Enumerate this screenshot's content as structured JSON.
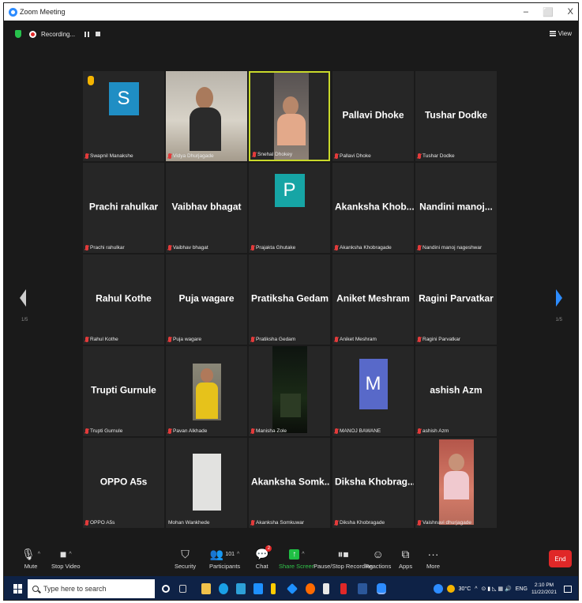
{
  "window": {
    "title": "Zoom Meeting",
    "controls": [
      "–",
      "⬜",
      "X"
    ]
  },
  "recording": {
    "label": "Recording..."
  },
  "view": {
    "label": "View"
  },
  "pager": {
    "left": "1/5",
    "right": "1/5"
  },
  "participants": [
    {
      "display": "",
      "label": "Swapnil Manakshe",
      "type": "avatar",
      "letter": "S"
    },
    {
      "display": "",
      "label": "Vidya Dhurjagade",
      "type": "photo"
    },
    {
      "display": "",
      "label": "Snehal Dhokey",
      "type": "photo"
    },
    {
      "display": "Pallavi Dhoke",
      "label": "Pallavi Dhoke",
      "type": "name"
    },
    {
      "display": "Tushar Dodke",
      "label": "Tushar Dodke",
      "type": "name"
    },
    {
      "display": "Prachi rahulkar",
      "label": "Prachi rahulkar",
      "type": "name"
    },
    {
      "display": "Vaibhav bhagat",
      "label": "Vaibhav bhagat",
      "type": "name"
    },
    {
      "display": "",
      "label": "Prajakta Ghutake",
      "type": "avatar",
      "letter": "P"
    },
    {
      "display": "Akanksha Khob...",
      "label": "Akanksha Khobragade",
      "type": "name"
    },
    {
      "display": "Nandini manoj...",
      "label": "Nandini manoj nageshwar",
      "type": "name"
    },
    {
      "display": "Rahul Kothe",
      "label": "Rahul Kothe",
      "type": "name"
    },
    {
      "display": "Puja wagare",
      "label": "Puja wagare",
      "type": "name"
    },
    {
      "display": "Pratiksha Gedam",
      "label": "Pratiksha Gedam",
      "type": "name"
    },
    {
      "display": "Aniket Meshram",
      "label": "Aniket Meshram",
      "type": "name"
    },
    {
      "display": "Ragini Parvatkar",
      "label": "Ragini Parvatkar",
      "type": "name"
    },
    {
      "display": "Trupti Gurnule",
      "label": "Trupti Gurnule",
      "type": "name"
    },
    {
      "display": "",
      "label": "Pavan Alkhade",
      "type": "photo"
    },
    {
      "display": "",
      "label": "Manisha Zole",
      "type": "photo"
    },
    {
      "display": "",
      "label": "MANOJ BAWANE",
      "type": "avatar",
      "letter": "M"
    },
    {
      "display": "ashish Azm",
      "label": "ashish Azm",
      "type": "name"
    },
    {
      "display": "OPPO A5s",
      "label": "OPPO A5s",
      "type": "name"
    },
    {
      "display": "",
      "label": "Mohan Wankhede",
      "type": "photo"
    },
    {
      "display": "Akanksha Somk...",
      "label": "Akanksha Somkuwar",
      "type": "name"
    },
    {
      "display": "Diksha Khobrag...",
      "label": "Diksha Khobragade",
      "type": "name"
    },
    {
      "display": "",
      "label": "Vaishnavi dhurjagade",
      "type": "photo"
    }
  ],
  "toolbar": {
    "mute": "Mute",
    "stop_video": "Stop Video",
    "security": "Security",
    "participants": "Participants",
    "participants_count": "101",
    "chat": "Chat",
    "chat_badge": "2",
    "share_screen": "Share Screen",
    "pause_recording": "Pause/Stop Recording",
    "reactions": "Reactions",
    "apps": "Apps",
    "more": "More",
    "end": "End"
  },
  "taskbar": {
    "search_placeholder": "Type here to search",
    "weather": "30°C",
    "lang": "ENG",
    "time": "2:10 PM",
    "date": "11/22/2021"
  },
  "colors": {
    "active_border": "#c9d92b",
    "end_red": "#e02828",
    "share_green": "#31c34a",
    "taskbar": "#0e2246"
  }
}
